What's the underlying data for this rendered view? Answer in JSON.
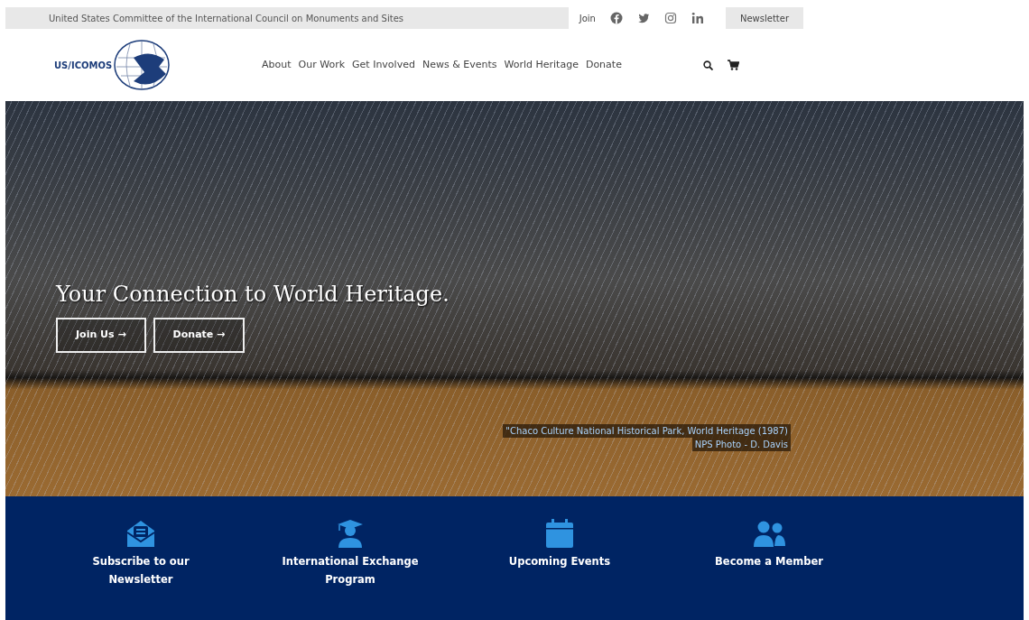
{
  "top_bar": {
    "tagline": "United States Committee of the International Council on Monuments and Sites",
    "join": "Join",
    "social": [
      {
        "kind": "facebook"
      },
      {
        "kind": "twitter"
      },
      {
        "kind": "instagram"
      },
      {
        "kind": "linkedin"
      }
    ],
    "newsletter": "Newsletter"
  },
  "header": {
    "logo": "US/ICOMOS",
    "nav": [
      "About",
      "Our Work",
      "Get Involved",
      "News & Events",
      "World Heritage",
      "Donate"
    ]
  },
  "hero": {
    "headline": "Your Connection to World Heritage.",
    "buttons": [
      "Join Us →",
      "Donate →"
    ],
    "caption": [
      "\"Chaco Culture National Historical Park, World Heritage (1987)",
      "NPS Photo - D. Davis"
    ]
  },
  "features": [
    {
      "kind": "newsletter",
      "label": "Subscribe to our Newsletter"
    },
    {
      "kind": "education",
      "label": "International Exchange Program"
    },
    {
      "kind": "calendar",
      "label": "Upcoming Events"
    },
    {
      "kind": "members",
      "label": "Become a Member"
    }
  ]
}
